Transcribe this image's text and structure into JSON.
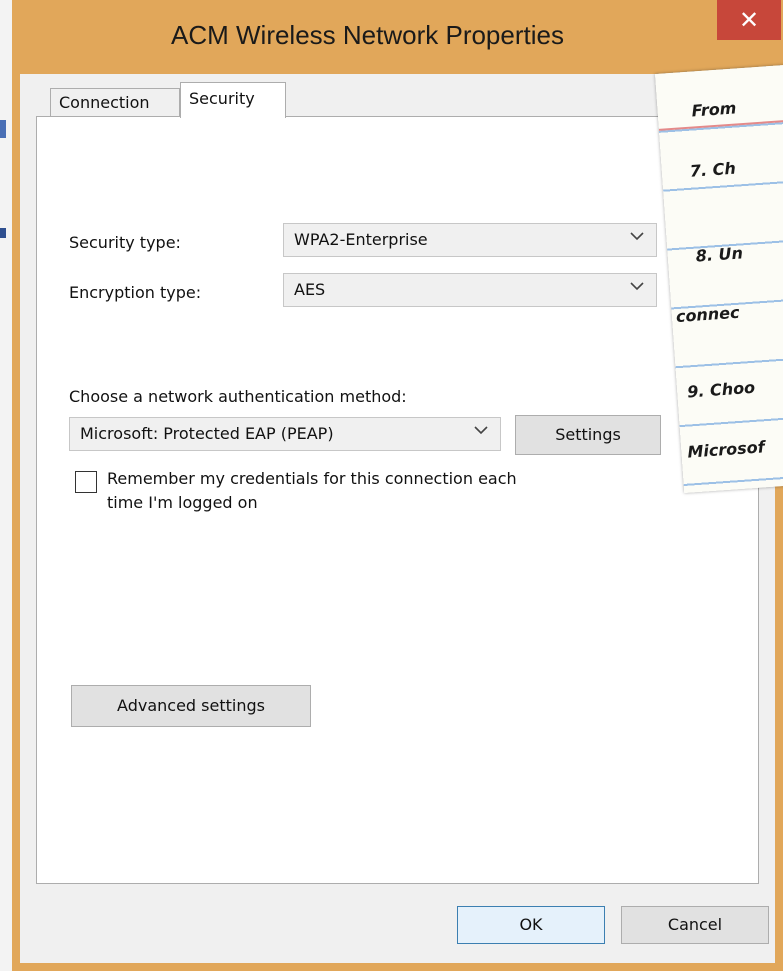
{
  "window": {
    "title": "ACM Wireless Network Properties",
    "close_glyph": "✕"
  },
  "tabs": [
    {
      "label": "Connection",
      "selected": false
    },
    {
      "label": "Security",
      "selected": true
    }
  ],
  "security": {
    "security_type_label": "Security type:",
    "security_type_value": "WPA2-Enterprise",
    "encryption_type_label": "Encryption type:",
    "encryption_type_value": "AES",
    "auth_method_label": "Choose a network authentication method:",
    "auth_method_value": "Microsoft: Protected EAP (PEAP)",
    "settings_button": "Settings",
    "remember_line1": "Remember my credentials for this connection each",
    "remember_line2": "time I'm logged on",
    "remember_checked": false,
    "advanced_button": "Advanced settings"
  },
  "footer": {
    "ok_label": "OK",
    "cancel_label": "Cancel"
  },
  "notebook": {
    "lines": [
      "From",
      "7. Ch",
      "8. Un",
      "connec",
      "9. Choo",
      "Microsof"
    ]
  },
  "icons": {
    "dropdown": "chevron-down-icon",
    "close": "close-icon"
  },
  "colors": {
    "title_bar": "#e1a75a",
    "close_button": "#c7473a",
    "ok_border": "#3c7fb1"
  }
}
